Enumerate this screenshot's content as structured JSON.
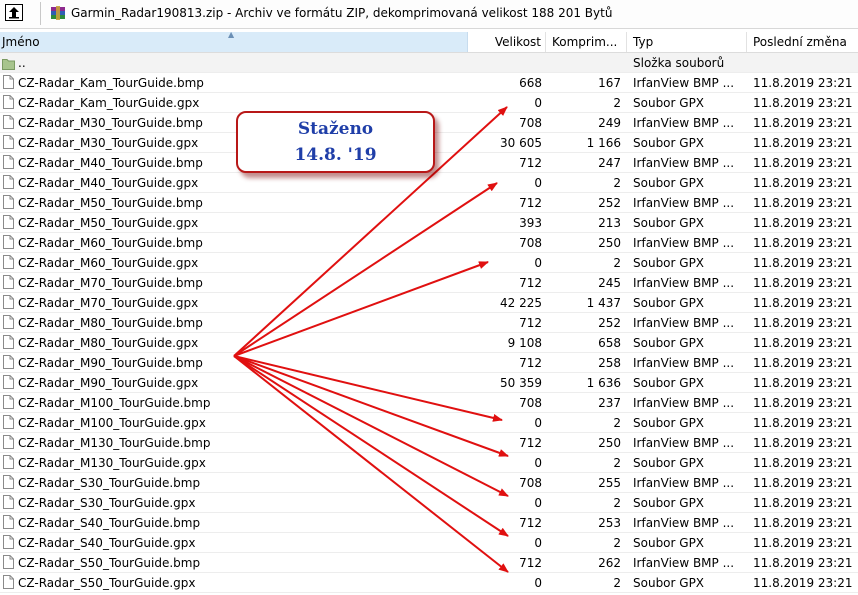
{
  "window": {
    "title": "Garmin_Radar190813.zip - Archiv ve formátu ZIP, dekomprimovaná velikost 188 201 Bytů",
    "up_icon": "up-folder-icon",
    "archive_icon": "winrar-archive-icon"
  },
  "columns": {
    "name": "Jméno",
    "size": "Velikost",
    "compressed": "Komprim...",
    "type": "Typ",
    "modified": "Poslední změna"
  },
  "parent_row": {
    "name": "..",
    "type": "Složka souborů"
  },
  "files": [
    {
      "name": "CZ-Radar_Kam_TourGuide.bmp",
      "size": "668",
      "compressed": "167",
      "type": "IrfanView BMP ...",
      "modified": "11.8.2019 23:21"
    },
    {
      "name": "CZ-Radar_Kam_TourGuide.gpx",
      "size": "0",
      "compressed": "2",
      "type": "Soubor GPX",
      "modified": "11.8.2019 23:21"
    },
    {
      "name": "CZ-Radar_M30_TourGuide.bmp",
      "size": "708",
      "compressed": "249",
      "type": "IrfanView BMP ...",
      "modified": "11.8.2019 23:21"
    },
    {
      "name": "CZ-Radar_M30_TourGuide.gpx",
      "size": "30 605",
      "compressed": "1 166",
      "type": "Soubor GPX",
      "modified": "11.8.2019 23:21"
    },
    {
      "name": "CZ-Radar_M40_TourGuide.bmp",
      "size": "712",
      "compressed": "247",
      "type": "IrfanView BMP ...",
      "modified": "11.8.2019 23:21"
    },
    {
      "name": "CZ-Radar_M40_TourGuide.gpx",
      "size": "0",
      "compressed": "2",
      "type": "Soubor GPX",
      "modified": "11.8.2019 23:21"
    },
    {
      "name": "CZ-Radar_M50_TourGuide.bmp",
      "size": "712",
      "compressed": "252",
      "type": "IrfanView BMP ...",
      "modified": "11.8.2019 23:21"
    },
    {
      "name": "CZ-Radar_M50_TourGuide.gpx",
      "size": "393",
      "compressed": "213",
      "type": "Soubor GPX",
      "modified": "11.8.2019 23:21"
    },
    {
      "name": "CZ-Radar_M60_TourGuide.bmp",
      "size": "708",
      "compressed": "250",
      "type": "IrfanView BMP ...",
      "modified": "11.8.2019 23:21"
    },
    {
      "name": "CZ-Radar_M60_TourGuide.gpx",
      "size": "0",
      "compressed": "2",
      "type": "Soubor GPX",
      "modified": "11.8.2019 23:21"
    },
    {
      "name": "CZ-Radar_M70_TourGuide.bmp",
      "size": "712",
      "compressed": "245",
      "type": "IrfanView BMP ...",
      "modified": "11.8.2019 23:21"
    },
    {
      "name": "CZ-Radar_M70_TourGuide.gpx",
      "size": "42 225",
      "compressed": "1 437",
      "type": "Soubor GPX",
      "modified": "11.8.2019 23:21"
    },
    {
      "name": "CZ-Radar_M80_TourGuide.bmp",
      "size": "712",
      "compressed": "252",
      "type": "IrfanView BMP ...",
      "modified": "11.8.2019 23:21"
    },
    {
      "name": "CZ-Radar_M80_TourGuide.gpx",
      "size": "9 108",
      "compressed": "658",
      "type": "Soubor GPX",
      "modified": "11.8.2019 23:21"
    },
    {
      "name": "CZ-Radar_M90_TourGuide.bmp",
      "size": "712",
      "compressed": "258",
      "type": "IrfanView BMP ...",
      "modified": "11.8.2019 23:21"
    },
    {
      "name": "CZ-Radar_M90_TourGuide.gpx",
      "size": "50 359",
      "compressed": "1 636",
      "type": "Soubor GPX",
      "modified": "11.8.2019 23:21"
    },
    {
      "name": "CZ-Radar_M100_TourGuide.bmp",
      "size": "708",
      "compressed": "237",
      "type": "IrfanView BMP ...",
      "modified": "11.8.2019 23:21"
    },
    {
      "name": "CZ-Radar_M100_TourGuide.gpx",
      "size": "0",
      "compressed": "2",
      "type": "Soubor GPX",
      "modified": "11.8.2019 23:21"
    },
    {
      "name": "CZ-Radar_M130_TourGuide.bmp",
      "size": "712",
      "compressed": "250",
      "type": "IrfanView BMP ...",
      "modified": "11.8.2019 23:21"
    },
    {
      "name": "CZ-Radar_M130_TourGuide.gpx",
      "size": "0",
      "compressed": "2",
      "type": "Soubor GPX",
      "modified": "11.8.2019 23:21"
    },
    {
      "name": "CZ-Radar_S30_TourGuide.bmp",
      "size": "708",
      "compressed": "255",
      "type": "IrfanView BMP ...",
      "modified": "11.8.2019 23:21"
    },
    {
      "name": "CZ-Radar_S30_TourGuide.gpx",
      "size": "0",
      "compressed": "2",
      "type": "Soubor GPX",
      "modified": "11.8.2019 23:21"
    },
    {
      "name": "CZ-Radar_S40_TourGuide.bmp",
      "size": "712",
      "compressed": "253",
      "type": "IrfanView BMP ...",
      "modified": "11.8.2019 23:21"
    },
    {
      "name": "CZ-Radar_S40_TourGuide.gpx",
      "size": "0",
      "compressed": "2",
      "type": "Soubor GPX",
      "modified": "11.8.2019 23:21"
    },
    {
      "name": "CZ-Radar_S50_TourGuide.bmp",
      "size": "712",
      "compressed": "262",
      "type": "IrfanView BMP ...",
      "modified": "11.8.2019 23:21"
    },
    {
      "name": "CZ-Radar_S50_TourGuide.gpx",
      "size": "0",
      "compressed": "2",
      "type": "Soubor GPX",
      "modified": "11.8.2019 23:21"
    }
  ],
  "annotation": {
    "line1": "Staženo",
    "line2": "14.8. '19",
    "text_color": "#1f3ea8",
    "arrow_color": "#e01010"
  }
}
